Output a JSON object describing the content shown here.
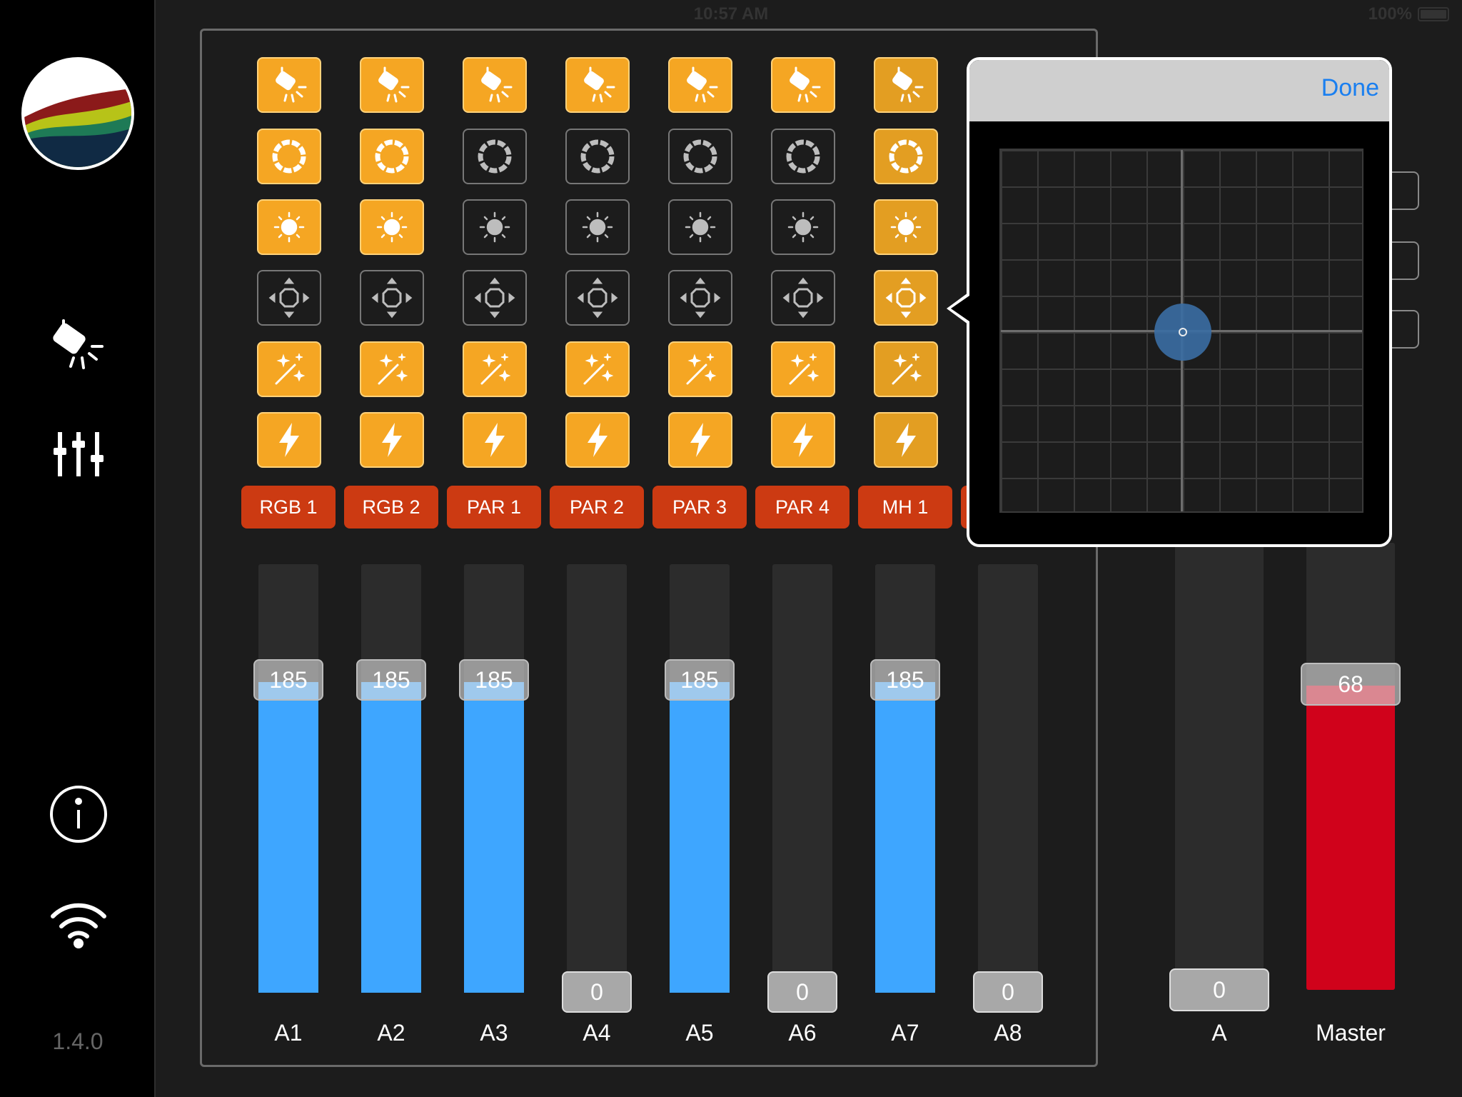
{
  "status_bar": {
    "time": "10:57 AM",
    "battery": "100%"
  },
  "sidebar": {
    "icons": [
      "logo",
      "fixture-icon",
      "mixer-icon",
      "info-icon",
      "wifi-icon"
    ],
    "version": "1.4.0"
  },
  "grid": {
    "row_icons": [
      "spotlight-icon",
      "color-wheel-icon",
      "dimmer-icon",
      "pan-tilt-icon",
      "effects-wand-icon",
      "strobe-icon"
    ],
    "states": [
      [
        "on",
        "on",
        "on",
        "on",
        "on",
        "on",
        "on"
      ],
      [
        "on",
        "on",
        "off",
        "off",
        "off",
        "off",
        "on"
      ],
      [
        "on",
        "on",
        "off",
        "off",
        "off",
        "off",
        "on"
      ],
      [
        "off",
        "off",
        "off",
        "off",
        "off",
        "off",
        "on"
      ],
      [
        "on",
        "on",
        "on",
        "on",
        "on",
        "on",
        "on"
      ],
      [
        "on",
        "on",
        "on",
        "on",
        "on",
        "on",
        "on"
      ]
    ]
  },
  "fixtures": [
    "RGB 1",
    "RGB 2",
    "PAR 1",
    "PAR 2",
    "PAR 3",
    "PAR 4",
    "MH 1"
  ],
  "faders": [
    {
      "label": "A1",
      "value": "185",
      "level": 0.725
    },
    {
      "label": "A2",
      "value": "185",
      "level": 0.725
    },
    {
      "label": "A3",
      "value": "185",
      "level": 0.725
    },
    {
      "label": "A4",
      "value": "0",
      "level": 0
    },
    {
      "label": "A5",
      "value": "185",
      "level": 0.725
    },
    {
      "label": "A6",
      "value": "0",
      "level": 0
    },
    {
      "label": "A7",
      "value": "185",
      "level": 0.725
    },
    {
      "label": "A8",
      "value": "0",
      "level": 0
    }
  ],
  "group_fader": {
    "label": "A",
    "value": "0",
    "level": 0
  },
  "master_fader": {
    "label": "Master",
    "value": "68",
    "level": 0.68
  },
  "popover": {
    "done_label": "Done",
    "pan": 0.5,
    "tilt": 0.5
  },
  "colors": {
    "accent": "#f5a623",
    "fixture_red": "#cc3a12",
    "fader_blue": "#3ea6ff",
    "master_red": "#d0021b",
    "link_blue": "#1a7ff0"
  }
}
